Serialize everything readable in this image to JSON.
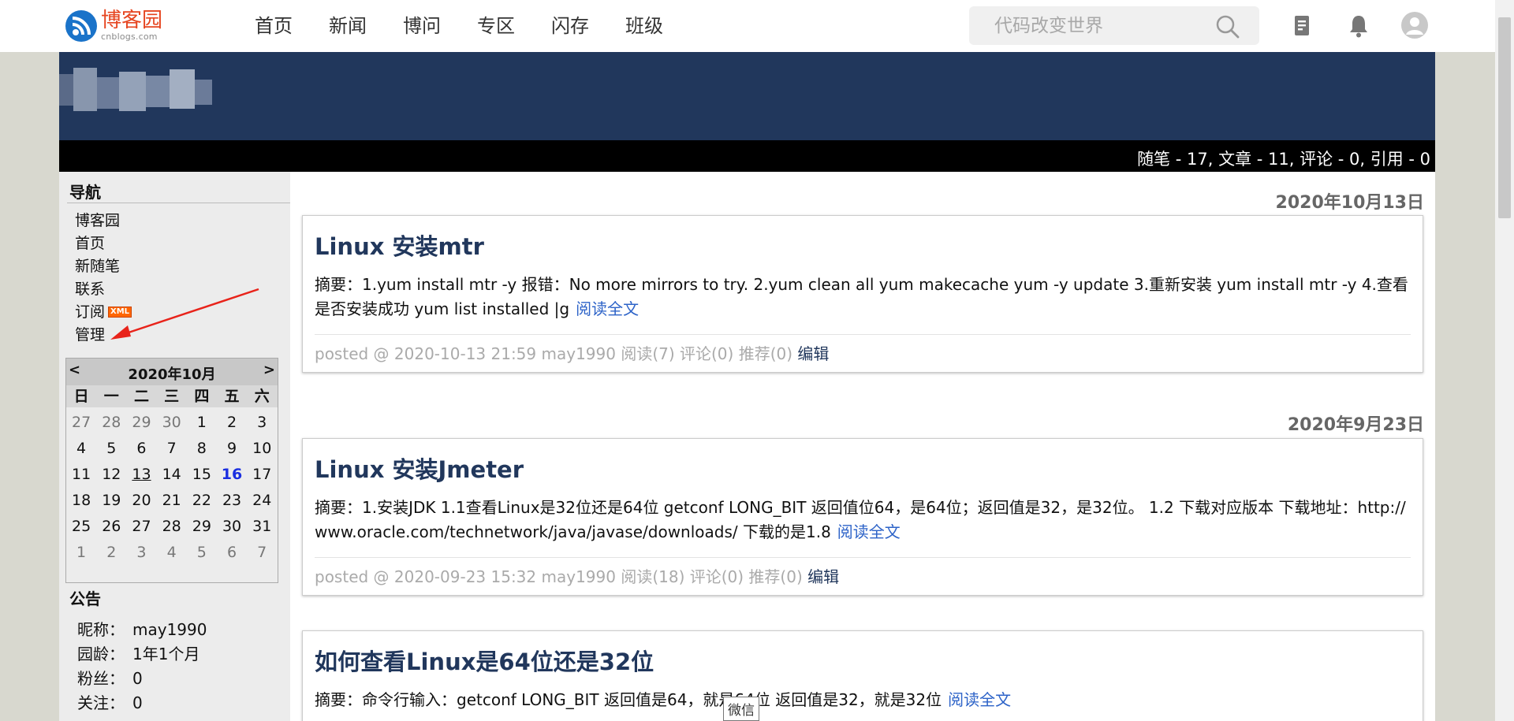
{
  "topnav": {
    "logo_text": "博客园",
    "logo_sub": "cnblogs.com",
    "menu": [
      "首页",
      "新闻",
      "博问",
      "专区",
      "闪存",
      "班级"
    ],
    "search_placeholder": "代码改变世界",
    "icons": [
      "search-icon",
      "drafts-icon",
      "bell-icon",
      "user-avatar-icon"
    ]
  },
  "header": {
    "stats": "随笔 - 17, 文章 - 11, 评论 - 0, 引用 - 0"
  },
  "sidebar": {
    "nav_heading": "导航",
    "nav_items": [
      "博客园",
      "首页",
      "新随笔",
      "联系",
      "订阅",
      "管理"
    ],
    "xml_badge": "XML",
    "calendar": {
      "prev": "<",
      "title": "2020年10月",
      "next": ">",
      "weekdays": [
        "日",
        "一",
        "二",
        "三",
        "四",
        "五",
        "六"
      ],
      "rows": [
        [
          "27",
          "28",
          "29",
          "30",
          "1",
          "2",
          "3"
        ],
        [
          "4",
          "5",
          "6",
          "7",
          "8",
          "9",
          "10"
        ],
        [
          "11",
          "12",
          "13",
          "14",
          "15",
          "16",
          "17"
        ],
        [
          "18",
          "19",
          "20",
          "21",
          "22",
          "23",
          "24"
        ],
        [
          "25",
          "26",
          "27",
          "28",
          "29",
          "30",
          "31"
        ],
        [
          "1",
          "2",
          "3",
          "4",
          "5",
          "6",
          "7"
        ]
      ],
      "linked_day": "13",
      "today": "16"
    },
    "notice_heading": "公告",
    "notice": [
      {
        "k": "昵称：",
        "v": "may1990"
      },
      {
        "k": "园龄：",
        "v": "1年1个月"
      },
      {
        "k": "粉丝：",
        "v": "0"
      },
      {
        "k": "关注：",
        "v": "0"
      }
    ]
  },
  "posts": [
    {
      "date": "2020年10月13日",
      "title": "Linux 安装mtr",
      "summary": "摘要：1.yum install mtr -y 报错：No more mirrors to try. 2.yum clean all yum makecache yum -y update 3.重新安装 yum install mtr -y 4.查看是否安装成功 yum list installed |g",
      "read_more": "阅读全文",
      "footer": "posted @ 2020-10-13 21:59 may1990 阅读(7) 评论(0) 推荐(0)",
      "edit": "编辑"
    },
    {
      "date": "2020年9月23日",
      "title": "Linux 安装Jmeter",
      "summary": "摘要：1.安装JDK 1.1查看Linux是32位还是64位 getconf LONG_BIT 返回值位64，是64位；返回值是32，是32位。 1.2 下载对应版本 下载地址：http://www.oracle.com/technetwork/java/javase/downloads/ 下载的是1.8",
      "read_more": "阅读全文",
      "footer": "posted @ 2020-09-23 15:32 may1990 阅读(18) 评论(0) 推荐(0)",
      "edit": "编辑"
    },
    {
      "title": "如何查看Linux是64位还是32位",
      "summary": "摘要：命令行输入：getconf LONG_BIT 返回值是64，就是64位 返回值是32，就是32位",
      "read_more": "阅读全文"
    }
  ],
  "tooltip": "微信"
}
